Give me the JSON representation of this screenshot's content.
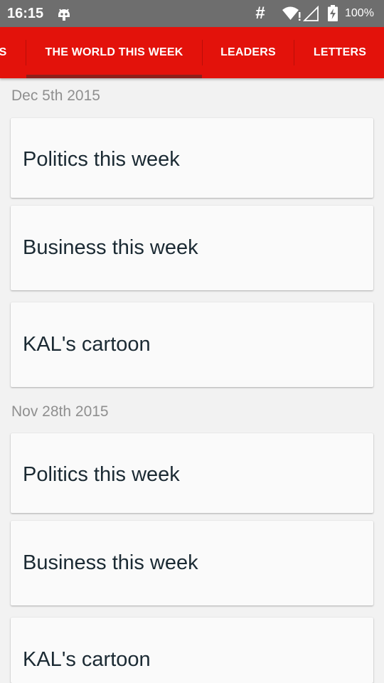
{
  "status_bar": {
    "time": "16:15",
    "hash_symbol": "#",
    "battery": "100%",
    "icons": [
      "android-debug-icon",
      "wifi-icon",
      "signal-icon",
      "battery-charging-icon"
    ]
  },
  "tabs": [
    {
      "label": "S",
      "active": false
    },
    {
      "label": "THE WORLD THIS WEEK",
      "active": true
    },
    {
      "label": "LEADERS",
      "active": false
    },
    {
      "label": "LETTERS",
      "active": false
    }
  ],
  "colors": {
    "accent": "#e3120b",
    "status_bar": "#6e6e6e",
    "indicator": "#8f1f1a",
    "background": "#f2f2f2",
    "card": "#fafafa",
    "title_text": "#1b2a33",
    "date_text": "#8f8f8f"
  },
  "sections": [
    {
      "date": "Dec 5th 2015",
      "items": [
        {
          "title": "Politics this week"
        },
        {
          "title": "Business this week"
        },
        {
          "title": "KAL's cartoon"
        }
      ]
    },
    {
      "date": "Nov 28th 2015",
      "items": [
        {
          "title": "Politics this week"
        },
        {
          "title": "Business this week"
        },
        {
          "title": "KAL's cartoon"
        }
      ]
    }
  ]
}
